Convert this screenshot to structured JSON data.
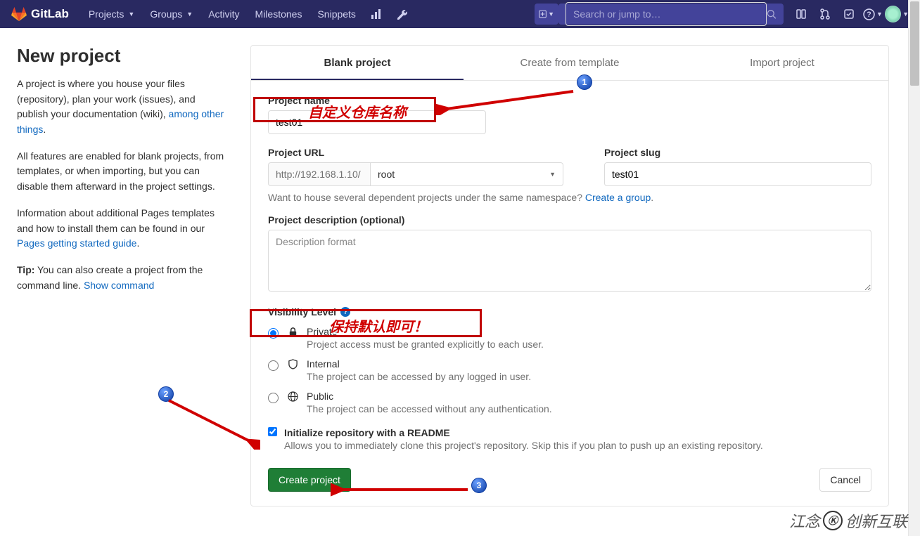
{
  "header": {
    "brand": "GitLab",
    "nav": [
      "Projects",
      "Groups",
      "Activity",
      "Milestones",
      "Snippets"
    ],
    "search_placeholder": "Search or jump to…"
  },
  "sidebar": {
    "title": "New project",
    "p1_a": "A project is where you house your files (repository), plan your work (issues), and publish your documentation (wiki), ",
    "p1_link": "among other things",
    "p2": "All features are enabled for blank projects, from templates, or when importing, but you can disable them afterward in the project settings.",
    "p3_a": "Information about additional Pages templates and how to install them can be found in our ",
    "p3_link": "Pages getting started guide",
    "p4_tip": "Tip:",
    "p4_a": " You can also create a project from the command line. ",
    "p4_link": "Show command"
  },
  "tabs": [
    "Blank project",
    "Create from template",
    "Import project"
  ],
  "form": {
    "name_label": "Project name",
    "name_value": "test01",
    "url_label": "Project URL",
    "url_base": "http://192.168.1.10/",
    "url_namespace": "root",
    "slug_label": "Project slug",
    "slug_value": "test01",
    "group_hint_a": "Want to house several dependent projects under the same namespace? ",
    "group_hint_link": "Create a group",
    "desc_label": "Project description (optional)",
    "desc_placeholder": "Description format",
    "vis_label": "Visibility Level",
    "vis": [
      {
        "title": "Private",
        "desc": "Project access must be granted explicitly to each user.",
        "checked": true,
        "icon": "lock"
      },
      {
        "title": "Internal",
        "desc": "The project can be accessed by any logged in user.",
        "checked": false,
        "icon": "shield"
      },
      {
        "title": "Public",
        "desc": "The project can be accessed without any authentication.",
        "checked": false,
        "icon": "globe"
      }
    ],
    "readme_title": "Initialize repository with a README",
    "readme_desc": "Allows you to immediately clone this project's repository. Skip this if you plan to push up an existing repository.",
    "create_btn": "Create project",
    "cancel_btn": "Cancel"
  },
  "annotations": {
    "box1_text": "自定义仓库名称",
    "box2_text": "保持默认即可！",
    "badges": [
      "1",
      "2",
      "3"
    ]
  },
  "watermark": {
    "text1": "江念",
    "text2": "创新互联"
  }
}
